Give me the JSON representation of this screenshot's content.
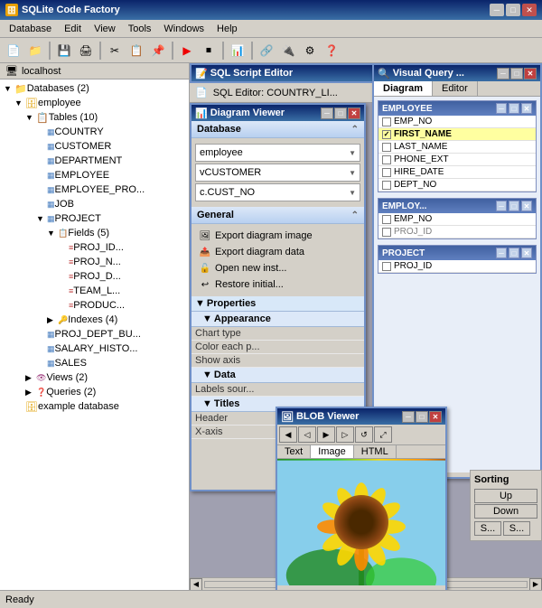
{
  "app": {
    "title": "SQLite Code Factory",
    "icon": "🗄"
  },
  "titlebar": {
    "title": "SQLite Code Factory",
    "min": "─",
    "max": "□",
    "close": "✕"
  },
  "menu": {
    "items": [
      "Database",
      "Edit",
      "View",
      "Tools",
      "Windows",
      "Help"
    ]
  },
  "left_panel": {
    "header": "localhost",
    "tree": [
      {
        "label": "Databases (2)",
        "indent": 1,
        "type": "folder",
        "expanded": true
      },
      {
        "label": "employee",
        "indent": 2,
        "type": "db",
        "expanded": true
      },
      {
        "label": "Tables (10)",
        "indent": 3,
        "type": "folder",
        "expanded": true
      },
      {
        "label": "COUNTRY",
        "indent": 4,
        "type": "table"
      },
      {
        "label": "CUSTOMER",
        "indent": 4,
        "type": "table"
      },
      {
        "label": "DEPARTMENT",
        "indent": 4,
        "type": "table"
      },
      {
        "label": "EMPLOYEE",
        "indent": 4,
        "type": "table"
      },
      {
        "label": "EMPLOYEE_PRO...",
        "indent": 4,
        "type": "table"
      },
      {
        "label": "JOB",
        "indent": 4,
        "type": "table"
      },
      {
        "label": "PROJECT",
        "indent": 4,
        "type": "table",
        "expanded": true
      },
      {
        "label": "Fields (5)",
        "indent": 5,
        "type": "folder",
        "expanded": true
      },
      {
        "label": "PROJ_ID...",
        "indent": 6,
        "type": "field"
      },
      {
        "label": "PROJ_N...",
        "indent": 6,
        "type": "field"
      },
      {
        "label": "PROJ_D...",
        "indent": 6,
        "type": "field"
      },
      {
        "label": "TEAM_L...",
        "indent": 6,
        "type": "field"
      },
      {
        "label": "PRODUC...",
        "indent": 6,
        "type": "field"
      },
      {
        "label": "Indexes (4)",
        "indent": 5,
        "type": "folder"
      },
      {
        "label": "PROJ_DEPT_BU...",
        "indent": 4,
        "type": "table"
      },
      {
        "label": "SALARY_HISTO...",
        "indent": 4,
        "type": "table"
      },
      {
        "label": "SALES",
        "indent": 4,
        "type": "table"
      },
      {
        "label": "Views (2)",
        "indent": 3,
        "type": "folder"
      },
      {
        "label": "Queries (2)",
        "indent": 3,
        "type": "folder"
      },
      {
        "label": "example database",
        "indent": 2,
        "type": "db"
      }
    ]
  },
  "sql_editor": {
    "title": "SQL Script Editor",
    "sub_title": "SQL Editor: COUNTRY_LI..."
  },
  "diagram_viewer": {
    "title": "Diagram Viewer",
    "sections": {
      "database": {
        "label": "Database",
        "db_value": "employee",
        "table_value": "vCUSTOMER",
        "field_value": "c.CUST_NO"
      },
      "general": {
        "label": "General",
        "actions": [
          "Export diagram image",
          "Export diagram data",
          "Open new inst...",
          "Restore initial..."
        ]
      },
      "properties": {
        "label": "Properties",
        "appearance": {
          "label": "Appearance",
          "rows": [
            {
              "label": "Chart type",
              "value": ""
            },
            {
              "label": "Color each p...",
              "value": ""
            },
            {
              "label": "Show axis",
              "value": ""
            }
          ]
        },
        "data": {
          "label": "Data",
          "rows": [
            {
              "label": "Labels sour...",
              "value": ""
            }
          ]
        },
        "titles": {
          "label": "Titles",
          "rows": [
            {
              "label": "Header",
              "value": ""
            },
            {
              "label": "X-axis",
              "value": ""
            }
          ]
        }
      }
    }
  },
  "visual_query": {
    "title": "Visual Query ...",
    "tabs": [
      "Diagram",
      "Editor"
    ],
    "active_tab": "Diagram",
    "tables": [
      {
        "name": "EMPLOYEE",
        "fields": [
          "EMP_NO",
          "FIRST_NAME",
          "LAST_NAME",
          "PHONE_EXT",
          "HIRE_DATE",
          "DEPT_NO"
        ],
        "selected_field": "FIRST_NAME"
      },
      {
        "name": "EMPLOY...",
        "fields": [
          "EMP_NO",
          "PROJ_ID"
        ]
      },
      {
        "name": "PROJECT",
        "fields": [
          "PROJ_ID"
        ]
      }
    ]
  },
  "blob_viewer": {
    "title": "BLOB Viewer",
    "tabs": [
      "Text",
      "Image",
      "HTML"
    ],
    "active_tab": "Image",
    "buttons": [
      "◀",
      "◁",
      "▶",
      "▷",
      "⟳",
      "⤢"
    ]
  },
  "sorting": {
    "label": "Sorting",
    "buttons": [
      "Up",
      "Down",
      "S...",
      "S..."
    ]
  },
  "properties_panel": {
    "appearance_label": "Appearance",
    "chart_type_label": "Chart type",
    "color_each_label": "Color each p...",
    "show_axis_label": "Show axis",
    "data_label": "Data",
    "labels_source_label": "Labels sour...",
    "titles_label": "Titles",
    "header_label": "Header",
    "xaxis_label": "X-axis"
  }
}
